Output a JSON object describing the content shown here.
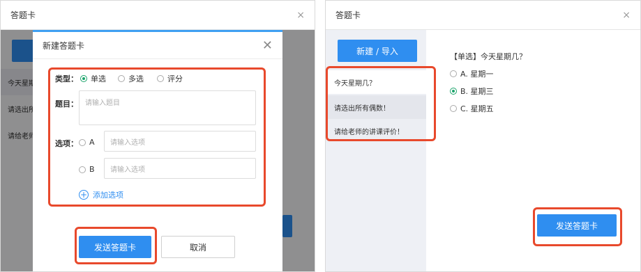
{
  "left": {
    "window_title": "答题卡",
    "close_symbol": "×",
    "bg_items": [
      "今天星期",
      "请选出所",
      "请给老师"
    ],
    "modal": {
      "title": "新建答题卡",
      "close_symbol": "✕",
      "type_label": "类型：",
      "type_options": [
        "单选",
        "多选",
        "评分"
      ],
      "question_label": "题目：",
      "question_placeholder": "请输入题目",
      "options_label": "选项：",
      "option_letters": [
        "A",
        "B"
      ],
      "option_placeholder": "请输入选项",
      "add_option": "添加选项",
      "send_button": "发送答题卡",
      "cancel_button": "取消"
    }
  },
  "right": {
    "window_title": "答题卡",
    "close_symbol": "×",
    "new_import_button": "新建 / 导入",
    "questions": [
      "今天星期几？",
      "请选出所有偶数！",
      "请给老师的讲课评价！"
    ],
    "current_question": "【单选】今天星期几？",
    "answers": [
      "A. 星期一",
      "B. 星期三",
      "C. 星期五"
    ],
    "selected_answer_index": 1,
    "send_button": "发送答题卡"
  },
  "colors": {
    "primary": "#2f8ef0",
    "highlight": "#e8492c",
    "radio_checked": "#1aa36a",
    "sidebar_bg": "#eef0f5"
  }
}
